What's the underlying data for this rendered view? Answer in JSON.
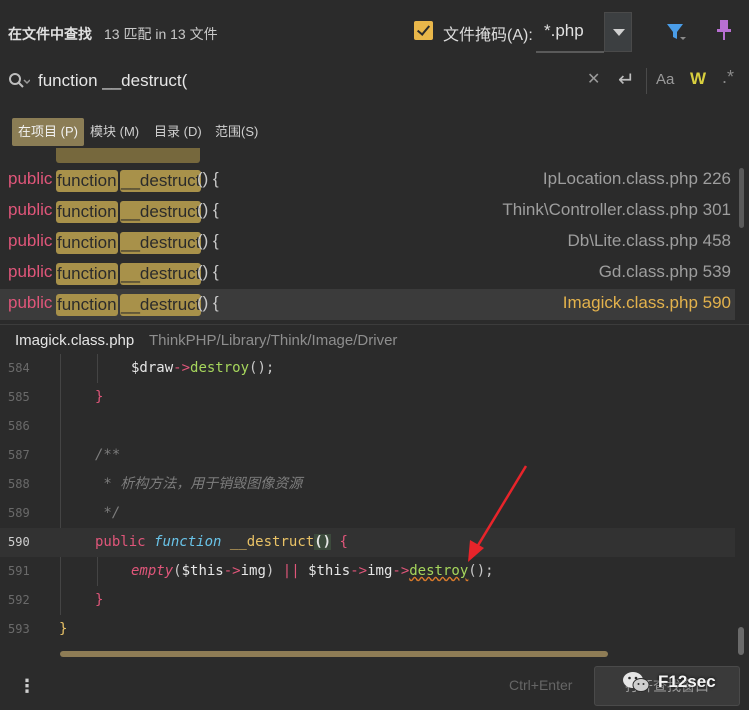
{
  "header": {
    "title": "在文件中查找",
    "match_count": "13 匹配 in 13 文件",
    "file_mask_label": "文件掩码(A):",
    "file_mask_value": "*.php"
  },
  "search": {
    "query": "function __destruct(",
    "match_case_label": "Aa",
    "words_label": "W"
  },
  "scopes": [
    {
      "label": "在项目 (P)",
      "active": true
    },
    {
      "label": "模块 (M)",
      "active": false
    },
    {
      "label": "目录 (D)",
      "active": false
    },
    {
      "label": "范围(S)",
      "active": false
    }
  ],
  "results": [
    {
      "keyword": "public",
      "hl1": "function",
      "hl2": "__destruct",
      "tail": "() {",
      "file": "IpLocation.class.php 226",
      "selected": false
    },
    {
      "keyword": "public",
      "hl1": "function",
      "hl2": "__destruct",
      "tail": "() {",
      "file": "Think\\Controller.class.php 301",
      "selected": false
    },
    {
      "keyword": "public",
      "hl1": "function",
      "hl2": "__destruct",
      "tail": "() {",
      "file": "Db\\Lite.class.php 458",
      "selected": false
    },
    {
      "keyword": "public",
      "hl1": "function",
      "hl2": "__destruct",
      "tail": "() {",
      "file": "Gd.class.php 539",
      "selected": false
    },
    {
      "keyword": "public",
      "hl1": "function",
      "hl2": "__destruct",
      "tail": "() {",
      "file": "Imagick.class.php 590",
      "selected": true
    }
  ],
  "preview": {
    "file": "Imagick.class.php",
    "path": "ThinkPHP/Library/Think/Image/Driver"
  },
  "code": {
    "line_numbers": [
      "584",
      "585",
      "586",
      "587",
      "588",
      "589",
      "590",
      "591",
      "592",
      "593"
    ],
    "l584": {
      "var": "$draw",
      "op": "->",
      "fn": "destroy",
      "rest": "();"
    },
    "l585": "}",
    "l587": "/**",
    "l588": " * 析构方法，用于销毁图像资源",
    "l589": " */",
    "l590": {
      "kw": "public",
      "fkw": "function",
      "name": "__destruct",
      "paren": "()",
      "brace": "{"
    },
    "l591": {
      "empty": "empty",
      "p1": "(",
      "this1": "$this",
      "a1": "->",
      "img1": "img",
      "p2": ")",
      "or": "||",
      "this2": "$this",
      "a2": "->",
      "img2": "img",
      "a3": "->",
      "destroy": "destroy",
      "end": "();"
    },
    "l592": "}",
    "l593": "}"
  },
  "footer": {
    "shortcut": "Ctrl+Enter",
    "open_button": "打开查找窗口",
    "watermark": "F12sec"
  },
  "colors": {
    "accent": "#e9b74a",
    "highlight": "#a8914a",
    "keyword": "#e0567a",
    "selected_file": "#e3b24c"
  }
}
